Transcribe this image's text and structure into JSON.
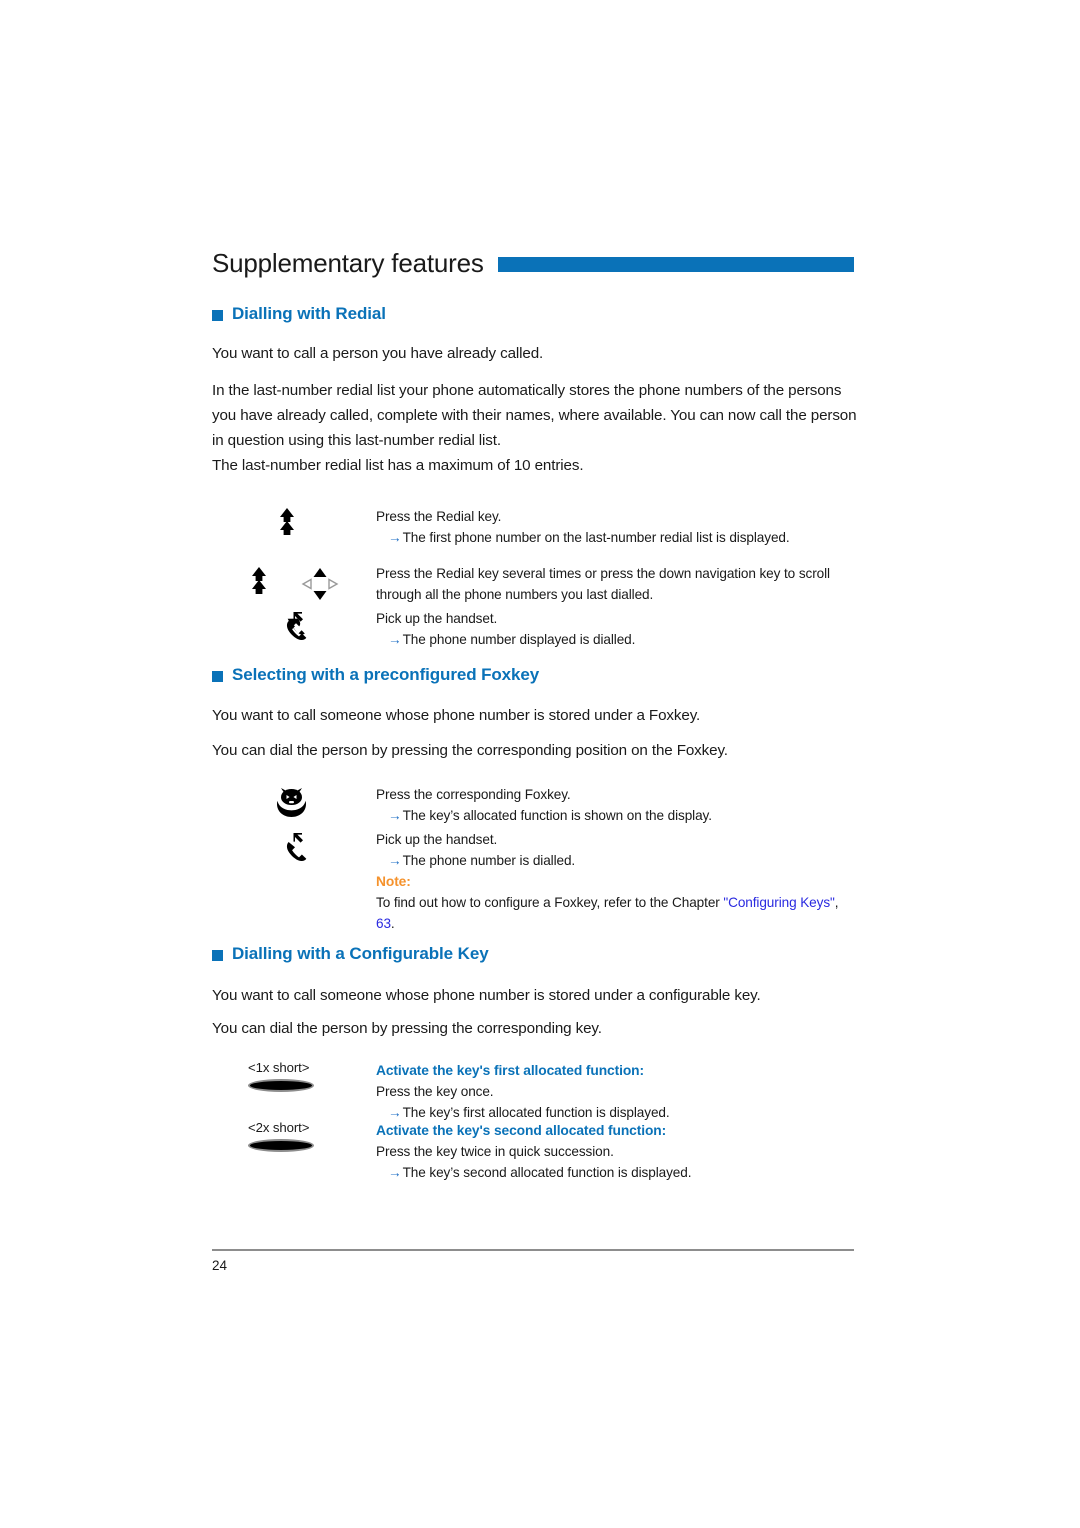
{
  "document": {
    "chapter_title": "Supplementary features",
    "page_number": "24",
    "accent_blue": "#0a72b8",
    "note_orange": "#f5922c",
    "link_blue": "#2a2ae0"
  },
  "section1": {
    "heading": "Dialling with Redial",
    "p1": "You want to call a person you have already called.",
    "p2": "In the last-number redial list your phone automatically stores the phone numbers of the persons you have already called, complete with their names, where available. You can now call the person in question using this last-number redial list.",
    "p3": "The last-number redial list has a maximum of 10 entries.",
    "steps": [
      {
        "icon": "redial-key-icon",
        "action": "Press the Redial key.",
        "result": "The first phone number on the last-number redial list is displayed."
      },
      {
        "icon": "redial-key-and-navigation-key-icon",
        "action": "Press the Redial key several times or press the down navigation key to scroll through all the phone numbers you last dialled.",
        "result": ""
      },
      {
        "icon": "handset-icon",
        "action": "Pick up the handset.",
        "result": "The phone number displayed is dialled."
      }
    ]
  },
  "section2": {
    "heading": "Selecting with a preconfigured Foxkey",
    "p1": "You want to call someone whose phone number is stored under a Foxkey.",
    "p2": "You can dial the person by pressing the corresponding position on the Foxkey.",
    "steps": [
      {
        "icon": "foxkey-icon",
        "action": "Press the corresponding Foxkey.",
        "result": "The key’s allocated function is shown on the display."
      },
      {
        "icon": "handset-icon",
        "action": "Pick up the handset.",
        "result": "The phone number is dialled."
      }
    ],
    "note": {
      "label": "Note:",
      "text_before": "To find out how to configure a Foxkey, refer to the Chapter ",
      "link1": "\"Configuring Keys\"",
      "text_mid": ", ",
      "link2": "63",
      "text_after": "."
    }
  },
  "section3": {
    "heading": "Dialling with a Configurable Key",
    "p1": "You want to call someone whose phone number is stored under a configurable key.",
    "p2": "You can dial the person by pressing the corresponding key.",
    "steps": [
      {
        "icon": "configurable-key-icon",
        "key_label": "<1x short>",
        "title": "Activate the key's first allocated function:",
        "action": "Press the key once.",
        "result": "The key’s first allocated function is displayed."
      },
      {
        "icon": "configurable-key-icon",
        "key_label": "<2x short>",
        "title": "Activate the key's second allocated function:",
        "action": "Press the key twice in quick succession.",
        "result": "The key’s second allocated function is displayed."
      }
    ]
  }
}
